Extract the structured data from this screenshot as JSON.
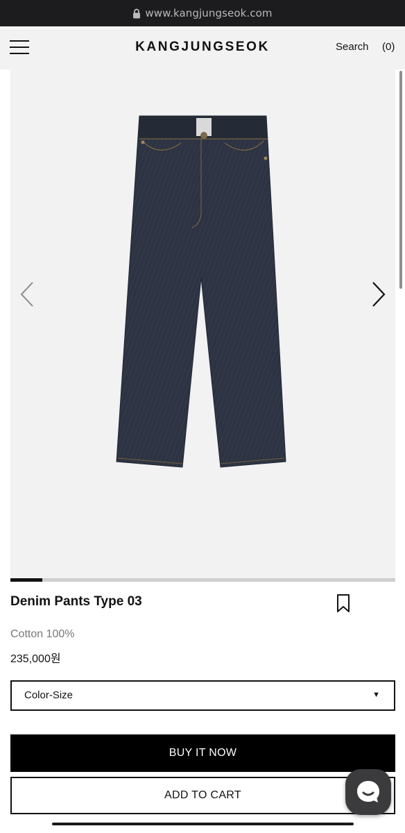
{
  "browser": {
    "url": "www.kangjungseok.com",
    "lock_icon": "lock-icon"
  },
  "header": {
    "brand": "KANGJUNGSEOK",
    "search_label": "Search",
    "cart_label": "(0)",
    "menu_icon": "hamburger-menu-icon"
  },
  "gallery": {
    "product_image": "dark indigo raw denim jeans",
    "prev_icon": "chevron-left-icon",
    "next_icon": "chevron-right-icon",
    "progress_fraction": 0.083
  },
  "product": {
    "title": "Denim Pants Type 03",
    "material": "Cotton 100%",
    "price": "235,000원",
    "bookmark_icon": "bookmark-icon"
  },
  "options": {
    "select_label": "Color-Size",
    "caret": "▼"
  },
  "actions": {
    "buy_now": "BUY IT NOW",
    "add_to_cart": "ADD TO CART"
  },
  "chat": {
    "icon": "chat-bubble-icon"
  },
  "colors": {
    "accent": "#000000",
    "gallery_bg": "#f2f2f2",
    "denim": "#2c3240",
    "chat_bg": "#3b3b3d"
  }
}
